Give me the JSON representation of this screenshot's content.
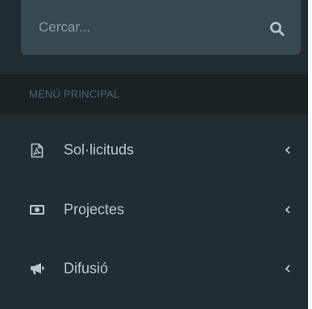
{
  "search": {
    "placeholder": "Cercar...",
    "icon": "search-icon"
  },
  "menu": {
    "header": "MENÚ PRINCIPAL",
    "items": [
      {
        "label": "Sol·licituds",
        "icon": "pdf-file-icon"
      },
      {
        "label": "Projectes",
        "icon": "money-icon"
      },
      {
        "label": "Difusió",
        "icon": "bullhorn-icon"
      }
    ]
  },
  "colors": {
    "sidebar_bg": "#222d32",
    "search_bg": "#374850",
    "header_bg": "#1a2226",
    "header_text": "#4b646f",
    "item_text": "#b8c7ce"
  }
}
